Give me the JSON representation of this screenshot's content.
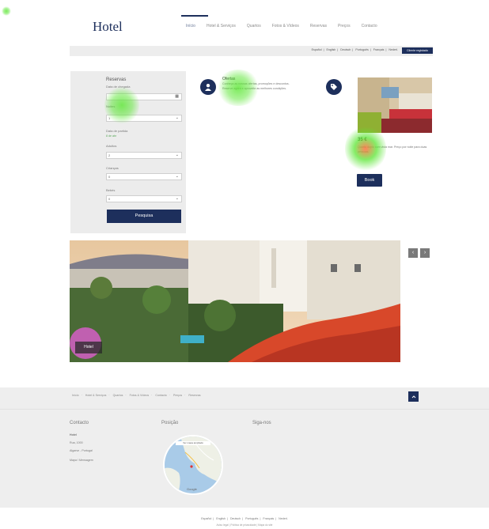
{
  "header": {
    "logo": "Hotel",
    "nav": [
      "Início",
      "Hotel & Serviços",
      "Quartos",
      "Fotos & Vídeos",
      "Reservas",
      "Preços",
      "Contacto"
    ]
  },
  "lang_bar": {
    "links": [
      "Español",
      "English",
      "Deutsch",
      "Português",
      "Français",
      "Nederl."
    ],
    "button": "Cliente registado"
  },
  "booking": {
    "title": "Reservas",
    "checkin_label": "Data de chegada",
    "nights_label": "Noites",
    "nights_value": "1",
    "checkout_label": "Data de partida",
    "checkout_value": "8 de abr",
    "adults_label": "Adultos",
    "adults_value": "2",
    "children_label": "Crianças",
    "children_value": "0",
    "babies_label": "Bebés",
    "babies_value": "0",
    "search_button": "Pesquisa"
  },
  "promo": {
    "title": "Ofertas",
    "text": "Conheça as nossas ofertas, promoções e descontos. Reserve agora e aproveite as melhores condições."
  },
  "room": {
    "price": "35 €",
    "text": "Quarto duplo com vista mar. Preço por noite para duas pessoas.",
    "book_button": "Book"
  },
  "hero": {
    "caption": "Hotel",
    "prev": "‹",
    "next": "›"
  },
  "footer": {
    "nav": [
      "Início",
      "Hotel & Serviços",
      "Quartos",
      "Fotos & Vídeos",
      "Contacto",
      "Preços",
      "Reservas"
    ],
    "contact_title": "Contacto",
    "contact_lines": [
      "Hotel",
      "Rua, 1000",
      "Algarve - Portugal",
      "Mapa / Mensagem"
    ],
    "position_title": "Posição",
    "map_label": "Ver mapa ampliado",
    "map_brand": "Google",
    "follow_title": "Siga-nos"
  },
  "bottom": {
    "langs": [
      "Español",
      "English",
      "Deutsch",
      "Português",
      "Français",
      "Nederl."
    ],
    "legal": "Aviso legal | Política de privacidade | Mapa do site"
  },
  "colors": {
    "brand_navy": "#1d2f5c",
    "panel_gray": "#ececec",
    "footer_gray": "#eeeeee"
  }
}
